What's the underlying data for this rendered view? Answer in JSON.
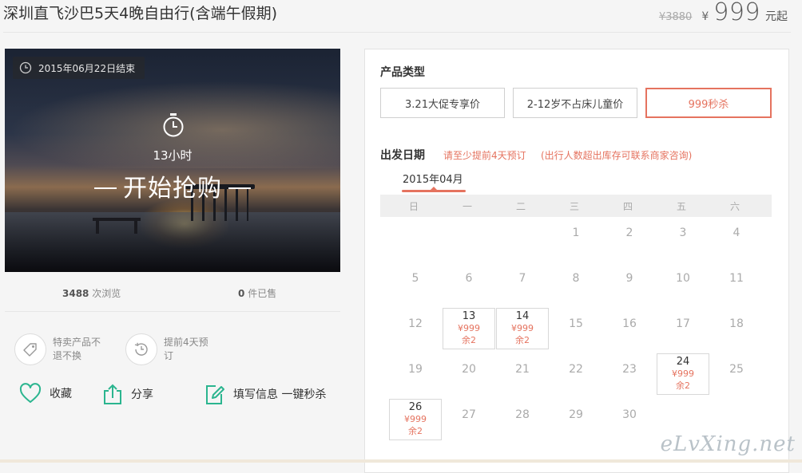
{
  "header": {
    "title": "深圳直飞沙巴5天4晚自由行(含端午假期)",
    "original_price": "¥3880",
    "currency": "¥",
    "price": "999",
    "price_unit": "元起"
  },
  "hero": {
    "end_date": "2015年06月22日结束",
    "countdown": "13小时",
    "cta": "开始抢购"
  },
  "stats": {
    "views_count": "3488",
    "views_label": "次浏览",
    "sold_count": "0",
    "sold_label": "件已售"
  },
  "guarantees": [
    {
      "icon": "tag-icon",
      "text_line1": "特卖产品不",
      "text_line2": "退不换"
    },
    {
      "icon": "clock-history-icon",
      "text_line1": "提前4天预",
      "text_line2": "订"
    }
  ],
  "actions": [
    {
      "icon": "heart-icon",
      "label": "收藏"
    },
    {
      "icon": "share-icon",
      "label": "分享"
    },
    {
      "icon": "edit-icon",
      "label": "填写信息 一键秒杀"
    }
  ],
  "product_type": {
    "label": "产品类型",
    "options": [
      "3.21大促专享价",
      "2-12岁不占床儿童价",
      "999秒杀"
    ],
    "selected_index": 2
  },
  "departure": {
    "label": "出发日期",
    "hint1": "请至少提前4天预订",
    "hint2": "(出行人数超出库存可联系商家咨询)",
    "month": "2015年04月",
    "weekdays": [
      "日",
      "一",
      "二",
      "三",
      "四",
      "五",
      "六"
    ],
    "weeks": [
      [
        "",
        "",
        "",
        "1",
        "2",
        "3",
        "4"
      ],
      [
        "5",
        "6",
        "7",
        "8",
        "9",
        "10",
        "11"
      ],
      [
        "12",
        "13",
        "14",
        "15",
        "16",
        "17",
        "18"
      ],
      [
        "19",
        "20",
        "21",
        "22",
        "23",
        "24",
        "25"
      ],
      [
        "26",
        "27",
        "28",
        "29",
        "30",
        "",
        ""
      ]
    ],
    "available": {
      "13": {
        "price": "¥999",
        "remain": "余2"
      },
      "14": {
        "price": "¥999",
        "remain": "余2"
      },
      "24": {
        "price": "¥999",
        "remain": "余2"
      },
      "26": {
        "price": "¥999",
        "remain": "余2"
      }
    }
  },
  "watermark": "eLvXing.net",
  "colors": {
    "accent": "#e5735f",
    "green": "#2bb58f"
  }
}
